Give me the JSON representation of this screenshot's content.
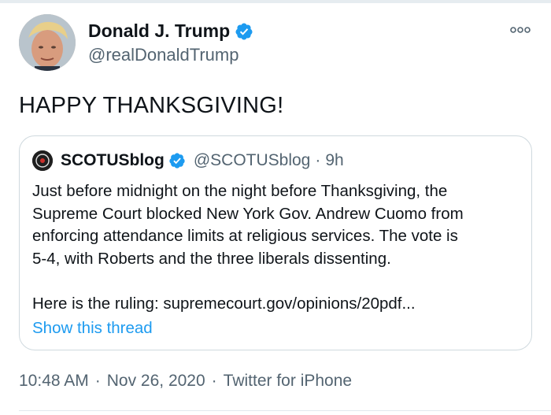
{
  "author": {
    "display_name": "Donald J. Trump",
    "handle": "@realDonaldTrump",
    "verified": true
  },
  "tweet": {
    "text": "HAPPY THANKSGIVING!",
    "time": "10:48 AM",
    "separator": "·",
    "date": "Nov 26, 2020",
    "source": "Twitter for iPhone"
  },
  "quoted_tweet": {
    "author": {
      "display_name": "SCOTUSblog",
      "handle": "@SCOTUSblog",
      "verified": true
    },
    "separator": "·",
    "relative_time": "9h",
    "body_lines": [
      "Just before midnight on the night before Thanksgiving, the",
      "Supreme Court blocked New York Gov. Andrew Cuomo from",
      "enforcing attendance limits at religious services. The vote is",
      "5-4, with Roberts and the three liberals dissenting."
    ],
    "ruling_line": "Here is the ruling: supremecourt.gov/opinions/20pdf...",
    "show_thread_label": "Show this thread"
  },
  "icons": {
    "verified": "verified-badge-icon",
    "more": "more-options-icon"
  },
  "colors": {
    "accent": "#1d9bf0",
    "secondary_text": "#536471",
    "primary_text": "#0f1419",
    "border": "#cfd9de"
  }
}
